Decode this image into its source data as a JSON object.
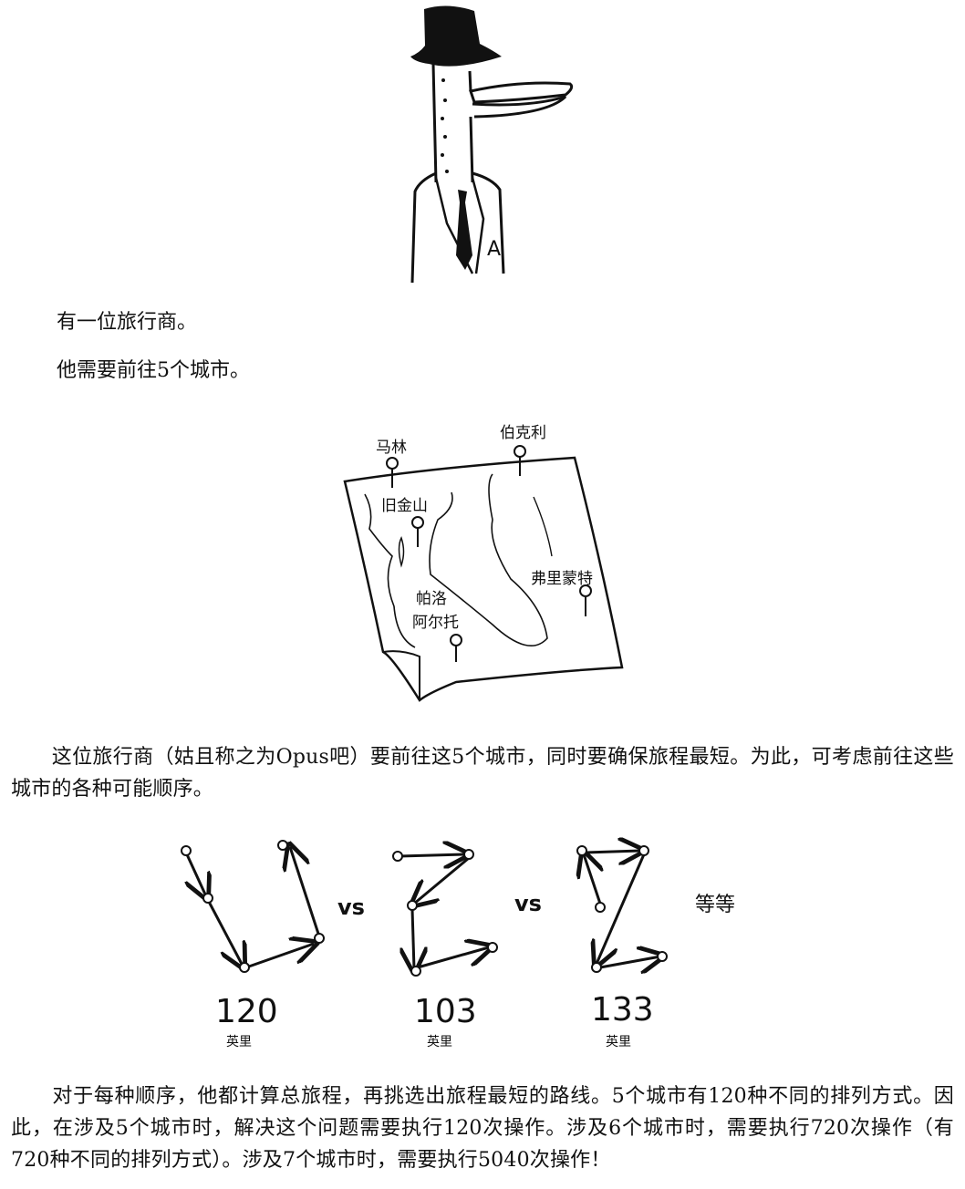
{
  "intro": {
    "line1": "有一位旅行商。",
    "line2": "他需要前往5个城市。"
  },
  "character": {
    "badge_letter": "A"
  },
  "map": {
    "cities": {
      "marin": "马林",
      "berkeley": "伯克利",
      "sf": "旧金山",
      "fremont": "弗里蒙特",
      "palo_alto_1": "帕洛",
      "palo_alto_2": "阿尔托"
    }
  },
  "paragraph1": "　　这位旅行商（姑且称之为Opus吧）要前往这5个城市，同时要确保旅程最短。为此，可考虑前往这些城市的各种可能顺序。",
  "routes": {
    "items": [
      {
        "distance": "120",
        "unit": "英里"
      },
      {
        "distance": "103",
        "unit": "英里"
      },
      {
        "distance": "133",
        "unit": "英里"
      }
    ],
    "vs1": "vs",
    "vs2": "vs",
    "etc": "等等"
  },
  "paragraph2": "　　对于每种顺序，他都计算总旅程，再挑选出旅程最短的路线。5个城市有120种不同的排列方式。因此，在涉及5个城市时，解决这个问题需要执行120次操作。涉及6个城市时，需要执行720次操作（有720种不同的排列方式）。涉及7个城市时，需要执行5040次操作！"
}
